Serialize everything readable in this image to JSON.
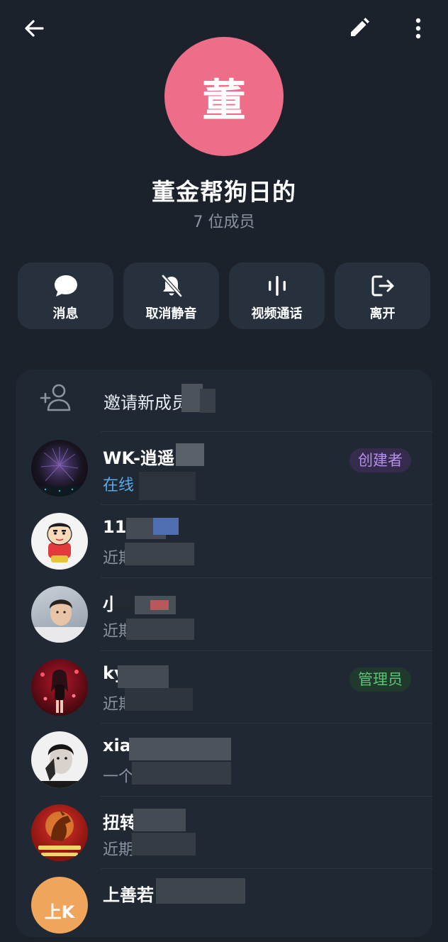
{
  "header": {
    "avatar_letter": "董",
    "title": "董金帮狗日的",
    "subtitle": "7 位成员"
  },
  "actions": [
    {
      "label": "消息",
      "icon": "message-bubble-icon"
    },
    {
      "label": "取消静音",
      "icon": "bell-off-icon"
    },
    {
      "label": "视频通话",
      "icon": "voice-wave-icon"
    },
    {
      "label": "离开",
      "icon": "leave-icon"
    }
  ],
  "invite": {
    "label": "邀请新成员"
  },
  "members": [
    {
      "name": "WK-逍遥",
      "status": "在线",
      "role": "创建者"
    },
    {
      "name": "11",
      "status": "近期"
    },
    {
      "name": "小",
      "status": "近期"
    },
    {
      "name": "ky",
      "status": "近期",
      "role": "管理员"
    },
    {
      "name": "xiar",
      "status": "一个"
    },
    {
      "name": "扭转",
      "status": "近期"
    },
    {
      "name": "上善若",
      "avatar_text": "上K"
    }
  ],
  "colors": {
    "background": "#1b222c",
    "card": "#202833",
    "avatar": "#ee6d89",
    "online": "#5aa9e6",
    "creator": "#b68ee8",
    "admin": "#5dc477"
  }
}
